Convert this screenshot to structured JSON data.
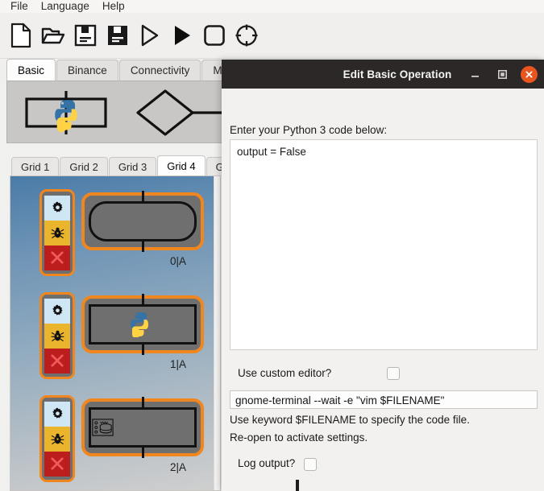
{
  "menubar": {
    "items": [
      {
        "label": "File"
      },
      {
        "label": "Language"
      },
      {
        "label": "Help"
      }
    ]
  },
  "toolbar": {
    "buttons": [
      {
        "name": "new-file",
        "icon": "new-file-icon"
      },
      {
        "name": "open-folder",
        "icon": "open-folder-icon"
      },
      {
        "name": "save",
        "icon": "save-icon"
      },
      {
        "name": "save-as",
        "icon": "save-filled-icon"
      },
      {
        "name": "step",
        "icon": "play-outline-icon"
      },
      {
        "name": "run",
        "icon": "play-filled-icon"
      },
      {
        "name": "stop",
        "icon": "stop-square-icon"
      },
      {
        "name": "target",
        "icon": "crosshair-icon"
      }
    ]
  },
  "palette": {
    "tabs": [
      {
        "label": "Basic",
        "active": true
      },
      {
        "label": "Binance",
        "active": false
      },
      {
        "label": "Connectivity",
        "active": false
      },
      {
        "label": "Mac",
        "active": false
      }
    ],
    "items": [
      {
        "name": "python-operation-shape",
        "icon": "python-logo-icon"
      },
      {
        "name": "decision-diamond-shape",
        "icon": "diamond-icon"
      },
      {
        "name": "rectangle-shape",
        "icon": "rectangle-icon"
      }
    ]
  },
  "grid": {
    "tabs": [
      {
        "label": "Grid 1",
        "active": false
      },
      {
        "label": "Grid 2",
        "active": false
      },
      {
        "label": "Grid 3",
        "active": false
      },
      {
        "label": "Grid 4",
        "active": true
      },
      {
        "label": "G",
        "active": false
      }
    ],
    "nodes": [
      {
        "label": "0|A",
        "shape": "rounded",
        "icon": "none",
        "controls": [
          {
            "name": "settings-button",
            "icon": "gear-icon"
          },
          {
            "name": "debug-button",
            "icon": "bug-icon"
          },
          {
            "name": "delete-button",
            "icon": "close-x-icon"
          }
        ]
      },
      {
        "label": "1|A",
        "shape": "rect",
        "icon": "python-logo-icon",
        "controls": [
          {
            "name": "settings-button",
            "icon": "gear-icon"
          },
          {
            "name": "debug-button",
            "icon": "bug-icon"
          },
          {
            "name": "delete-button",
            "icon": "close-x-icon"
          }
        ]
      },
      {
        "label": "2|A",
        "shape": "rect",
        "icon": "database-server-icon",
        "controls": [
          {
            "name": "settings-button",
            "icon": "gear-icon"
          },
          {
            "name": "debug-button",
            "icon": "bug-icon"
          },
          {
            "name": "delete-button",
            "icon": "close-x-icon"
          }
        ]
      }
    ]
  },
  "dialog": {
    "title": "Edit Basic Operation",
    "window_controls": {
      "minimize": "minimize-icon",
      "maximize": "maximize-icon",
      "close": "close-icon"
    },
    "code_prompt": "Enter your Python 3 code below:",
    "code_value": "output = False",
    "custom_editor_label": "Use custom editor?",
    "custom_editor_checked": false,
    "editor_command": "gnome-terminal --wait -e \"vim $FILENAME\"",
    "hint_line_1": "Use keyword $FILENAME to specify the code file.",
    "hint_line_2": "Re-open to activate settings.",
    "log_output_label": "Log output?",
    "log_output_checked": false
  },
  "colors": {
    "accent_orange": "#f0861e",
    "close_button": "#e9551f",
    "titlebar": "#2b2827",
    "node_body": "#6f6f6f",
    "gear_bg": "#cfe7f5",
    "bug_bg": "#eab52c",
    "delete_bg": "#bc1e1e"
  }
}
